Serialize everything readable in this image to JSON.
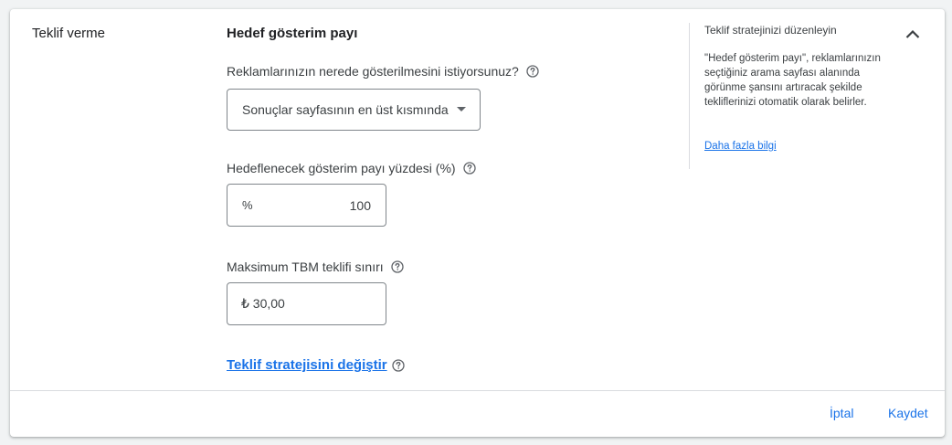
{
  "section": {
    "label": "Teklif verme"
  },
  "main": {
    "title": "Hedef gösterim payı",
    "location_label": "Reklamlarınızın nerede gösterilmesini istiyorsunuz?",
    "location_selected": "Sonuçlar sayfasının en üst kısmında",
    "share_label": "Hedeflenecek gösterim payı yüzdesi (%)",
    "share_prefix": "%",
    "share_value": "100",
    "cpc_label": "Maksimum TBM teklifi sınırı",
    "cpc_value": "₺ 30,00",
    "change_link": "Teklif stratejisini değiştir"
  },
  "side": {
    "title": "Teklif stratejinizi düzenleyin",
    "text": "\"Hedef gösterim payı\", reklamlarınızın seçtiğiniz arama sayfası alanında görünme şansını artıracak şekilde tekliflerinizi otomatik olarak belirler.",
    "link": "Daha fazla bilgi"
  },
  "footer": {
    "cancel": "İptal",
    "save": "Kaydet"
  },
  "icons": {
    "help": "help-circle-icon",
    "collapse": "chevron-up-icon",
    "dropdown": "dropdown-arrow-icon"
  },
  "colors": {
    "accent": "#1a73e8",
    "text": "#202124",
    "border": "#80868b"
  }
}
